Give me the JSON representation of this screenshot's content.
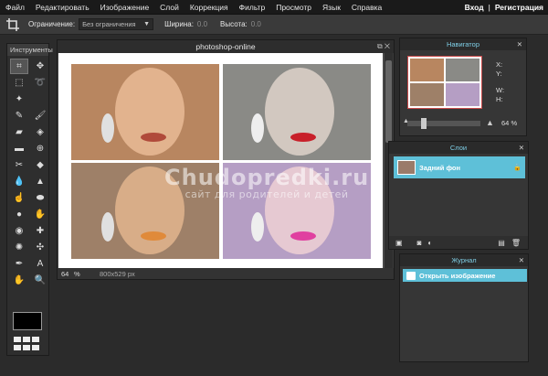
{
  "menu": {
    "items": [
      "Файл",
      "Редактировать",
      "Изображение",
      "Слой",
      "Коррекция",
      "Фильтр",
      "Просмотр",
      "Язык",
      "Справка"
    ],
    "login": "Вход",
    "register": "Регистрация"
  },
  "options": {
    "constraint_label": "Ограничение:",
    "constraint_value": "Без ограничения",
    "width_label": "Ширина:",
    "width_value": "0.0",
    "height_label": "Высота:",
    "height_value": "0.0"
  },
  "toolbox": {
    "title": "Инструменты"
  },
  "document": {
    "title": "photoshop-online",
    "zoom": "64",
    "zoom_unit": "%",
    "dimensions": "800x529 px"
  },
  "navigator": {
    "title": "Навигатор",
    "x_label": "X:",
    "y_label": "Y:",
    "w_label": "W:",
    "h_label": "H:",
    "zoom": "64",
    "zoom_unit": "%"
  },
  "layers": {
    "title": "Слои",
    "items": [
      {
        "name": "Задний фон",
        "selected": true
      }
    ]
  },
  "journal": {
    "title": "Журнал",
    "items": [
      {
        "name": "Открыть изображение",
        "selected": true
      }
    ]
  },
  "watermark": {
    "line1": "Chudopredki.ru",
    "line2": "сайт для родителей и детей"
  },
  "colors": {
    "accent": "#5ec0d8",
    "menubar": "#1a1a1a",
    "workspace": "#2b2b2b"
  }
}
